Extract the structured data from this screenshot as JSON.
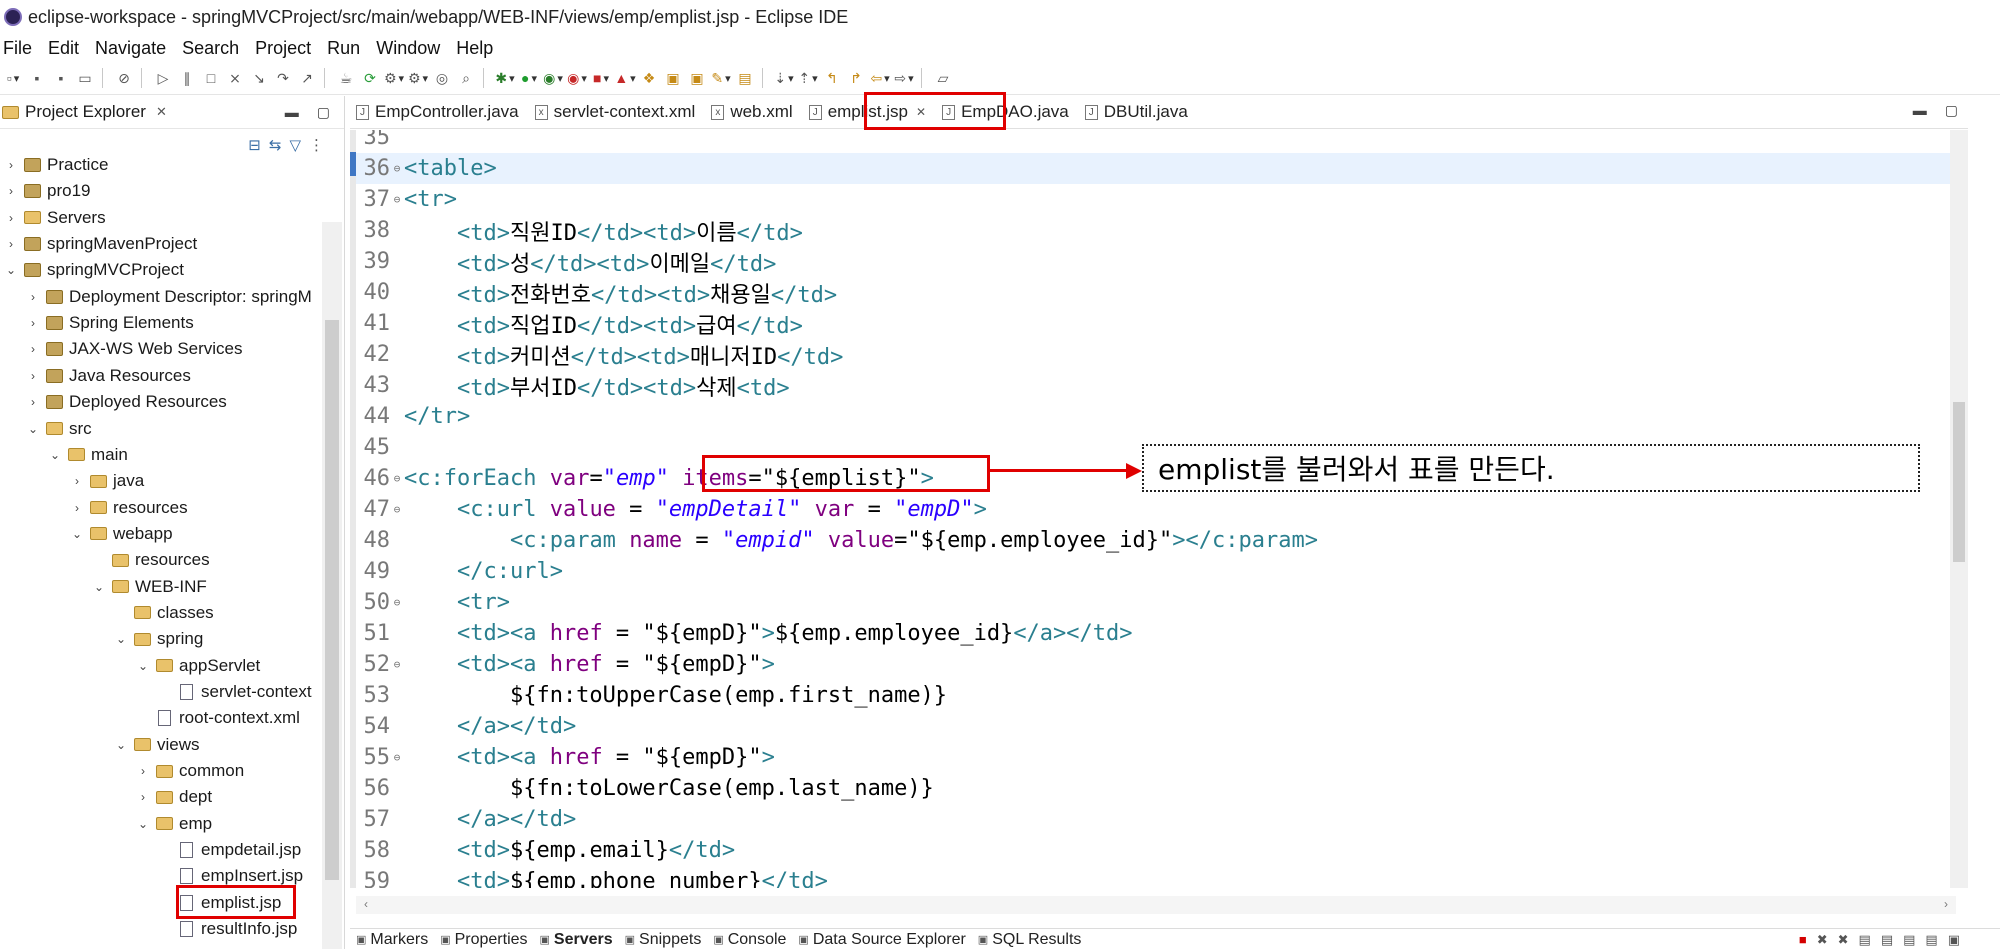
{
  "window": {
    "title": "eclipse-workspace - springMVCProject/src/main/webapp/WEB-INF/views/emp/emplist.jsp - Eclipse IDE"
  },
  "menu": [
    "File",
    "Edit",
    "Navigate",
    "Search",
    "Project",
    "Run",
    "Window",
    "Help"
  ],
  "project_explorer": {
    "title": "Project Explorer",
    "tree": [
      {
        "label": "Practice",
        "indent": 0,
        "twisty": ">",
        "icon": "project"
      },
      {
        "label": "pro19",
        "indent": 0,
        "twisty": ">",
        "icon": "project"
      },
      {
        "label": "Servers",
        "indent": 0,
        "twisty": ">",
        "icon": "folder"
      },
      {
        "label": "springMavenProject",
        "indent": 0,
        "twisty": ">",
        "icon": "project"
      },
      {
        "label": "springMVCProject",
        "indent": 0,
        "twisty": "v",
        "icon": "project"
      },
      {
        "label": "Deployment Descriptor: springM",
        "indent": 1,
        "twisty": ">",
        "icon": "descriptor"
      },
      {
        "label": "Spring Elements",
        "indent": 1,
        "twisty": ">",
        "icon": "spring"
      },
      {
        "label": "JAX-WS Web Services",
        "indent": 1,
        "twisty": ">",
        "icon": "webservice"
      },
      {
        "label": "Java Resources",
        "indent": 1,
        "twisty": ">",
        "icon": "javares"
      },
      {
        "label": "Deployed Resources",
        "indent": 1,
        "twisty": ">",
        "icon": "deployed"
      },
      {
        "label": "src",
        "indent": 1,
        "twisty": "v",
        "icon": "folder"
      },
      {
        "label": "main",
        "indent": 2,
        "twisty": "v",
        "icon": "folder"
      },
      {
        "label": "java",
        "indent": 3,
        "twisty": ">",
        "icon": "folder"
      },
      {
        "label": "resources",
        "indent": 3,
        "twisty": ">",
        "icon": "folder"
      },
      {
        "label": "webapp",
        "indent": 3,
        "twisty": "v",
        "icon": "folder"
      },
      {
        "label": "resources",
        "indent": 4,
        "twisty": "",
        "icon": "folder"
      },
      {
        "label": "WEB-INF",
        "indent": 4,
        "twisty": "v",
        "icon": "folder"
      },
      {
        "label": "classes",
        "indent": 5,
        "twisty": "",
        "icon": "folder"
      },
      {
        "label": "spring",
        "indent": 5,
        "twisty": "v",
        "icon": "folder"
      },
      {
        "label": "appServlet",
        "indent": 6,
        "twisty": "v",
        "icon": "folder"
      },
      {
        "label": "servlet-context",
        "indent": 7,
        "twisty": "",
        "icon": "xml"
      },
      {
        "label": "root-context.xml",
        "indent": 6,
        "twisty": "",
        "icon": "xml"
      },
      {
        "label": "views",
        "indent": 5,
        "twisty": "v",
        "icon": "folder"
      },
      {
        "label": "common",
        "indent": 6,
        "twisty": ">",
        "icon": "folder"
      },
      {
        "label": "dept",
        "indent": 6,
        "twisty": ">",
        "icon": "folder"
      },
      {
        "label": "emp",
        "indent": 6,
        "twisty": "v",
        "icon": "folder"
      },
      {
        "label": "empdetail.jsp",
        "indent": 7,
        "twisty": "",
        "icon": "jsp"
      },
      {
        "label": "empInsert.jsp",
        "indent": 7,
        "twisty": "",
        "icon": "jsp"
      },
      {
        "label": "emplist.jsp",
        "indent": 7,
        "twisty": "",
        "icon": "jsp",
        "highlight": true
      },
      {
        "label": "resultInfo.jsp",
        "indent": 7,
        "twisty": "",
        "icon": "jsp"
      }
    ]
  },
  "editor_tabs": [
    {
      "label": "EmpController.java",
      "icon": "J"
    },
    {
      "label": "servlet-context.xml",
      "icon": "x"
    },
    {
      "label": "web.xml",
      "icon": "x"
    },
    {
      "label": "emplist.jsp",
      "icon": "J",
      "active": true
    },
    {
      "label": "EmpDAO.java",
      "icon": "J"
    },
    {
      "label": "DBUtil.java",
      "icon": "J"
    }
  ],
  "code_lines": [
    {
      "n": "35",
      "fold": "",
      "parts": []
    },
    {
      "n": "36",
      "fold": "⊖",
      "current": true,
      "parts": [
        [
          "tag",
          "<table>"
        ]
      ]
    },
    {
      "n": "37",
      "fold": "⊖",
      "parts": [
        [
          "tag",
          "<tr>"
        ]
      ]
    },
    {
      "n": "38",
      "fold": "",
      "parts": [
        [
          "txt",
          "    "
        ],
        [
          "tag",
          "<td>"
        ],
        [
          "txt",
          "직원ID"
        ],
        [
          "tag",
          "</td><td>"
        ],
        [
          "txt",
          "이름"
        ],
        [
          "tag",
          "</td>"
        ]
      ]
    },
    {
      "n": "39",
      "fold": "",
      "parts": [
        [
          "txt",
          "    "
        ],
        [
          "tag",
          "<td>"
        ],
        [
          "txt",
          "성"
        ],
        [
          "tag",
          "</td><td>"
        ],
        [
          "txt",
          "이메일"
        ],
        [
          "tag",
          "</td>"
        ]
      ]
    },
    {
      "n": "40",
      "fold": "",
      "parts": [
        [
          "txt",
          "    "
        ],
        [
          "tag",
          "<td>"
        ],
        [
          "txt",
          "전화번호"
        ],
        [
          "tag",
          "</td><td>"
        ],
        [
          "txt",
          "채용일"
        ],
        [
          "tag",
          "</td>"
        ]
      ]
    },
    {
      "n": "41",
      "fold": "",
      "parts": [
        [
          "txt",
          "    "
        ],
        [
          "tag",
          "<td>"
        ],
        [
          "txt",
          "직업ID"
        ],
        [
          "tag",
          "</td><td>"
        ],
        [
          "txt",
          "급여"
        ],
        [
          "tag",
          "</td>"
        ]
      ]
    },
    {
      "n": "42",
      "fold": "",
      "parts": [
        [
          "txt",
          "    "
        ],
        [
          "tag",
          "<td>"
        ],
        [
          "txt",
          "커미션"
        ],
        [
          "tag",
          "</td><td>"
        ],
        [
          "txt",
          "매니저ID"
        ],
        [
          "tag",
          "</td>"
        ]
      ]
    },
    {
      "n": "43",
      "fold": "",
      "parts": [
        [
          "txt",
          "    "
        ],
        [
          "tag",
          "<td>"
        ],
        [
          "txt",
          "부서ID"
        ],
        [
          "tag",
          "</td><td>"
        ],
        [
          "txt",
          "삭제"
        ],
        [
          "tag",
          "<td>"
        ]
      ]
    },
    {
      "n": "44",
      "fold": "",
      "parts": [
        [
          "tag",
          "</tr>"
        ]
      ]
    },
    {
      "n": "45",
      "fold": "",
      "parts": []
    },
    {
      "n": "46",
      "fold": "⊖",
      "parts": [
        [
          "tag",
          "<c:forEach "
        ],
        [
          "attr",
          "var"
        ],
        [
          "txt",
          "="
        ],
        [
          "str",
          "\"emp\""
        ],
        [
          "txt",
          " "
        ],
        [
          "attr",
          "items"
        ],
        [
          "txt",
          "=\"${emplist}\""
        ],
        [
          "tag",
          ">"
        ]
      ]
    },
    {
      "n": "47",
      "fold": "⊖",
      "parts": [
        [
          "txt",
          "    "
        ],
        [
          "tag",
          "<c:url "
        ],
        [
          "attr",
          "value"
        ],
        [
          "txt",
          " = "
        ],
        [
          "str",
          "\"empDetail\""
        ],
        [
          "txt",
          " "
        ],
        [
          "attr",
          "var"
        ],
        [
          "txt",
          " = "
        ],
        [
          "str",
          "\"empD\""
        ],
        [
          "tag",
          ">"
        ]
      ]
    },
    {
      "n": "48",
      "fold": "",
      "parts": [
        [
          "txt",
          "        "
        ],
        [
          "tag",
          "<c:param "
        ],
        [
          "attr",
          "name"
        ],
        [
          "txt",
          " = "
        ],
        [
          "str",
          "\"empid\""
        ],
        [
          "txt",
          " "
        ],
        [
          "attr",
          "value"
        ],
        [
          "txt",
          "=\"${emp.employee_id}\""
        ],
        [
          "tag",
          "></c:param>"
        ]
      ]
    },
    {
      "n": "49",
      "fold": "",
      "parts": [
        [
          "txt",
          "    "
        ],
        [
          "tag",
          "</c:url>"
        ]
      ]
    },
    {
      "n": "50",
      "fold": "⊖",
      "parts": [
        [
          "txt",
          "    "
        ],
        [
          "tag",
          "<tr>"
        ]
      ]
    },
    {
      "n": "51",
      "fold": "",
      "parts": [
        [
          "txt",
          "    "
        ],
        [
          "tag",
          "<td><a "
        ],
        [
          "attr",
          "href"
        ],
        [
          "txt",
          " = \"${empD}\""
        ],
        [
          "tag",
          ">"
        ],
        [
          "txt",
          "${emp.employee_id}"
        ],
        [
          "tag",
          "</a></td>"
        ]
      ]
    },
    {
      "n": "52",
      "fold": "⊖",
      "parts": [
        [
          "txt",
          "    "
        ],
        [
          "tag",
          "<td><a "
        ],
        [
          "attr",
          "href"
        ],
        [
          "txt",
          " = \"${empD}\""
        ],
        [
          "tag",
          ">"
        ]
      ]
    },
    {
      "n": "53",
      "fold": "",
      "parts": [
        [
          "txt",
          "        ${fn:toUpperCase(emp.first_name)}"
        ]
      ]
    },
    {
      "n": "54",
      "fold": "",
      "parts": [
        [
          "txt",
          "    "
        ],
        [
          "tag",
          "</a></td>"
        ]
      ]
    },
    {
      "n": "55",
      "fold": "⊖",
      "parts": [
        [
          "txt",
          "    "
        ],
        [
          "tag",
          "<td><a "
        ],
        [
          "attr",
          "href"
        ],
        [
          "txt",
          " = \"${empD}\""
        ],
        [
          "tag",
          ">"
        ]
      ]
    },
    {
      "n": "56",
      "fold": "",
      "parts": [
        [
          "txt",
          "        ${fn:toLowerCase(emp.last_name)}"
        ]
      ]
    },
    {
      "n": "57",
      "fold": "",
      "parts": [
        [
          "txt",
          "    "
        ],
        [
          "tag",
          "</a></td>"
        ]
      ]
    },
    {
      "n": "58",
      "fold": "",
      "parts": [
        [
          "txt",
          "    "
        ],
        [
          "tag",
          "<td>"
        ],
        [
          "txt",
          "${emp.email}"
        ],
        [
          "tag",
          "</td>"
        ]
      ]
    },
    {
      "n": "59",
      "fold": "",
      "parts": [
        [
          "txt",
          "    "
        ],
        [
          "tag",
          "<td>"
        ],
        [
          "txt",
          "${emp.phone_number}"
        ],
        [
          "tag",
          "</td>"
        ]
      ]
    }
  ],
  "callout": {
    "text": "emplist를 불러와서 표를 만든다."
  },
  "bottom_tabs": [
    "Markers",
    "Properties",
    "Servers",
    "Snippets",
    "Console",
    "Data Source Explorer",
    "SQL Results"
  ],
  "colors": {
    "highlight": "#e00000",
    "current_line": "#e8f2fe",
    "tag": "#2a7f8f",
    "attribute": "#7f007f",
    "string": "#2a00ff"
  }
}
